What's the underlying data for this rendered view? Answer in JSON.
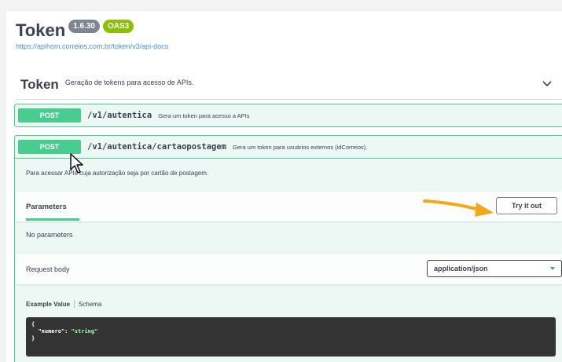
{
  "header": {
    "title": "Token",
    "version_badge": "1.6.30",
    "oas_badge": "OAS3",
    "url": "https://apihom.correios.com.br/token/v3/api-docs"
  },
  "tag": {
    "name": "Token",
    "description": "Geração de tokens para acesso de APIs."
  },
  "operations": [
    {
      "method": "POST",
      "path": "/v1/autentica",
      "summary": "Gera um token para acesso a APIs"
    },
    {
      "method": "POST",
      "path": "/v1/autentica/cartaopostagem",
      "summary": "Gera um token para usuários externos (idCorreios).",
      "description": "Para acessar APIs cuja autorização seja por cartão de postagem.",
      "parameters_title": "Parameters",
      "try_button": "Try it out",
      "no_parameters": "No parameters",
      "request_body_label": "Request body",
      "content_type": "application/json",
      "example_tab_active": "Example Value",
      "example_tab_other": "Schema",
      "example_line1": "{",
      "example_key": "\"numero\"",
      "example_colon": ": ",
      "example_value": "\"string\"",
      "example_line3": "}"
    }
  ],
  "colors": {
    "post": "#49cc90",
    "post_bg": "#edf8f4",
    "annotation_arrow": "#f3a81b"
  },
  "icons": [
    "chevron-down-icon",
    "mouse-cursor-icon",
    "annotation-arrow-icon",
    "select-caret-icon"
  ]
}
